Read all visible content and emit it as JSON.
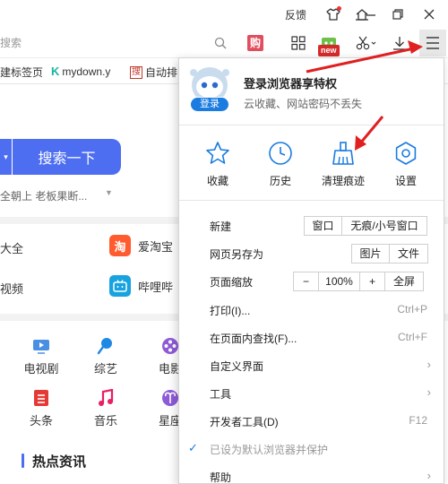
{
  "titlebar": {
    "feedback_label": "反馈",
    "icons": [
      "tshirt-icon",
      "skin-icon",
      "minimize-icon",
      "restore-icon",
      "close-icon"
    ]
  },
  "toolbar": {
    "search_placeholder": "搜索",
    "new_badge": "new",
    "baidu_glyph": "购",
    "menu_icon": "hamburger-icon"
  },
  "bookmarks": {
    "items": [
      {
        "label": "建标签页"
      },
      {
        "label": "mydown.y"
      },
      {
        "label": "自动排"
      }
    ],
    "mydown_glyph": "K",
    "auto_glyph": "搜"
  },
  "page": {
    "search_button": "搜索一下",
    "hot_text": "全朝上 老板果断...",
    "links": [
      {
        "label": "大全"
      },
      {
        "label": "爱淘宝",
        "icon_glyph": "淘",
        "icon_color": "#ff5b2e"
      },
      {
        "label": "视频"
      },
      {
        "label": "哔哩哔",
        "icon_color": "#17a2e0"
      }
    ],
    "grid": [
      {
        "label": "电视剧",
        "icon": "tv-icon",
        "color": "#4a90e2"
      },
      {
        "label": "综艺",
        "icon": "mic-icon",
        "color": "#1e88e5"
      },
      {
        "label": "电影",
        "icon": "film-icon",
        "color": "#8e5bd8"
      },
      {
        "label": "头条",
        "icon": "news-icon",
        "color": "#e53935"
      },
      {
        "label": "音乐",
        "icon": "music-icon",
        "color": "#e91e63"
      },
      {
        "label": "星座",
        "icon": "aries-icon",
        "color": "#8e5bd8"
      }
    ],
    "news_title": "热点资讯"
  },
  "menu": {
    "login_label": "登录",
    "user_title": "登录浏览器享特权",
    "user_subtitle": "云收藏、网站密码不丢失",
    "quick_actions": [
      {
        "label": "收藏",
        "icon": "star-icon"
      },
      {
        "label": "历史",
        "icon": "clock-icon"
      },
      {
        "label": "清理痕迹",
        "icon": "broom-icon"
      },
      {
        "label": "设置",
        "icon": "gear-icon"
      }
    ],
    "rows": {
      "new": {
        "label": "新建",
        "buttons": [
          "窗口",
          "无痕/小号窗口"
        ]
      },
      "save_as": {
        "label": "网页另存为",
        "buttons": [
          "图片",
          "文件"
        ]
      },
      "zoom": {
        "label": "页面缩放",
        "minus": "−",
        "value": "100%",
        "plus": "+",
        "fullscreen": "全屏"
      },
      "print": {
        "label": "打印(I)...",
        "shortcut": "Ctrl+P"
      },
      "find": {
        "label": "在页面内查找(F)...",
        "shortcut": "Ctrl+F"
      },
      "customize": {
        "label": "自定义界面"
      },
      "tools": {
        "label": "工具"
      },
      "devtools": {
        "label": "开发者工具(D)",
        "shortcut": "F12"
      },
      "default_browser": {
        "label": "已设为默认浏览器并保护",
        "check": "✓"
      },
      "help": {
        "label": "帮助"
      }
    },
    "chevron": "›"
  },
  "colors": {
    "accent_blue": "#1a7be0",
    "search_blue": "#4e6ef2",
    "annotation_red": "#e02020"
  }
}
